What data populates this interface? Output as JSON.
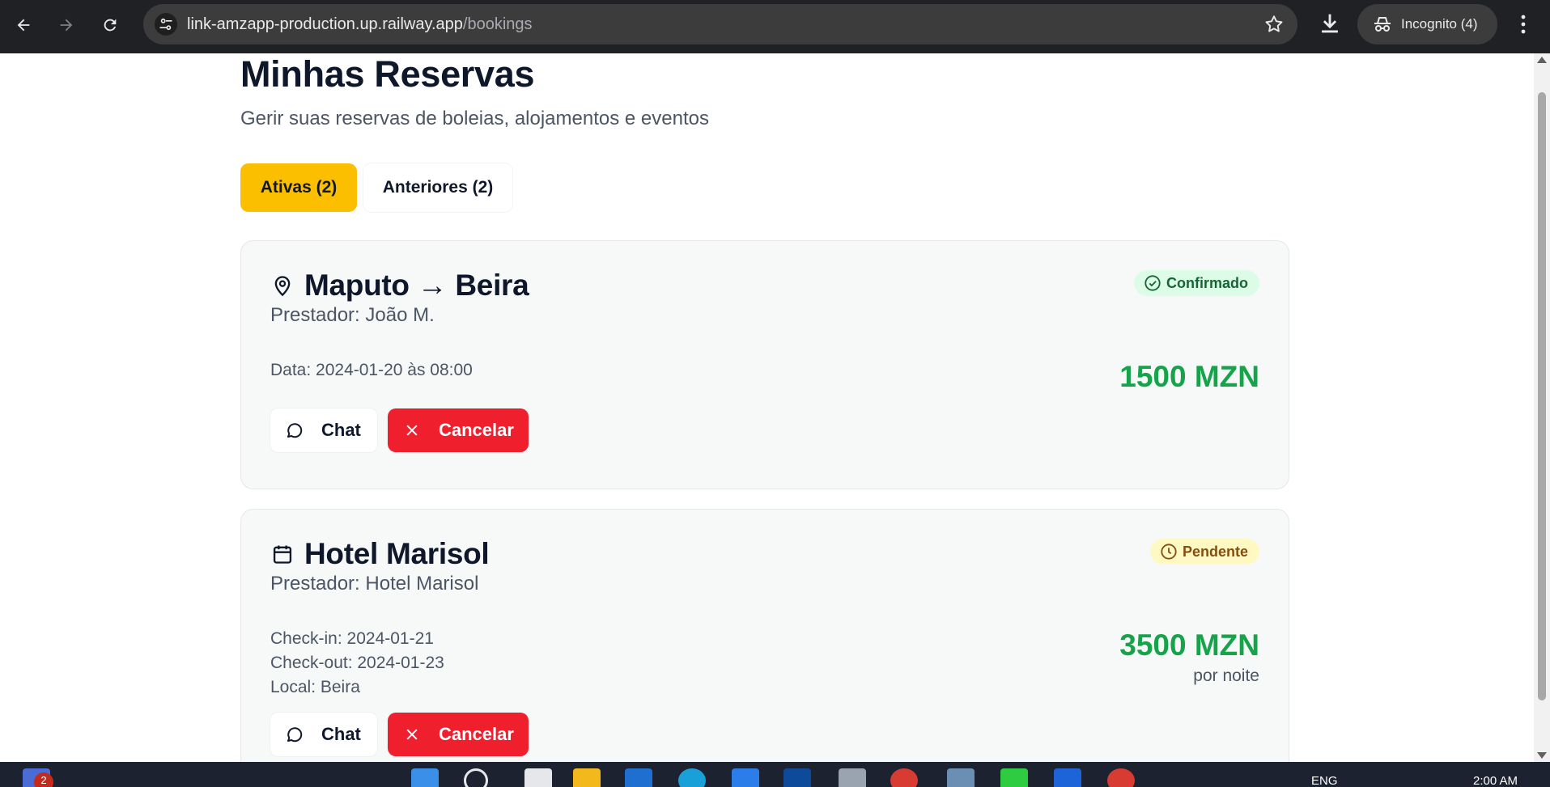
{
  "browser": {
    "url_host": "link-amzapp-production.up.railway.app",
    "url_path": "/bookings",
    "profile_label": "Incognito (4)",
    "icons": [
      "back-icon",
      "forward-icon",
      "reload-icon",
      "site-info-icon",
      "bookmark-star-icon",
      "download-icon",
      "incognito-icon",
      "menu-icon"
    ]
  },
  "page": {
    "title": "Minhas Reservas",
    "subtitle": "Gerir suas reservas de boleias, alojamentos e eventos"
  },
  "tabs": [
    {
      "label": "Ativas (2)",
      "active": true
    },
    {
      "label": "Anteriores (2)",
      "active": false
    }
  ],
  "bookings": [
    {
      "icon": "map-pin-icon",
      "title": "Maputo → Beira",
      "provider": "Prestador: João M.",
      "details": [
        "Data: 2024-01-20 às 08:00"
      ],
      "status": "Confirmado",
      "status_icon": "check-circle-icon",
      "price": "1500 MZN",
      "price_note": "",
      "chat_label": "Chat",
      "cancel_label": "Cancelar"
    },
    {
      "icon": "calendar-icon",
      "title": "Hotel Marisol",
      "provider": "Prestador: Hotel Marisol",
      "details": [
        "Check-in: 2024-01-21",
        "Check-out: 2024-01-23",
        "Local: Beira"
      ],
      "status": "Pendente",
      "status_icon": "clock-icon",
      "price": "3500 MZN",
      "price_note": "por noite",
      "chat_label": "Chat",
      "cancel_label": "Cancelar"
    }
  ],
  "colors": {
    "accent_tab": "#fcbf00",
    "price_green": "#16a34a",
    "cancel_red": "#ef1f2e",
    "confirmed_bg": "#dcfce7",
    "pending_bg": "#fef9c3"
  },
  "taskbar": {
    "notification_count": "2",
    "language": "ENG",
    "clock": "2:00 AM"
  }
}
